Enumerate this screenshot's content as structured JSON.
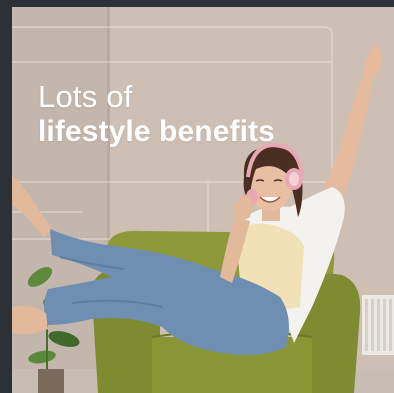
{
  "headline": {
    "line1": "Lots of",
    "line2": "lifestyle benefits"
  },
  "colors": {
    "frame": "#2c3138",
    "wall": "#cdbfb4",
    "chair": "#8e9a3a",
    "jeans": "#6f8fb2",
    "top": "#f1e1b7",
    "shirt": "#f4f2ee",
    "headphones": "#e8a9b4",
    "text": "#ffffff"
  },
  "image": {
    "subject": "woman-relaxing-in-armchair-with-headphones"
  }
}
